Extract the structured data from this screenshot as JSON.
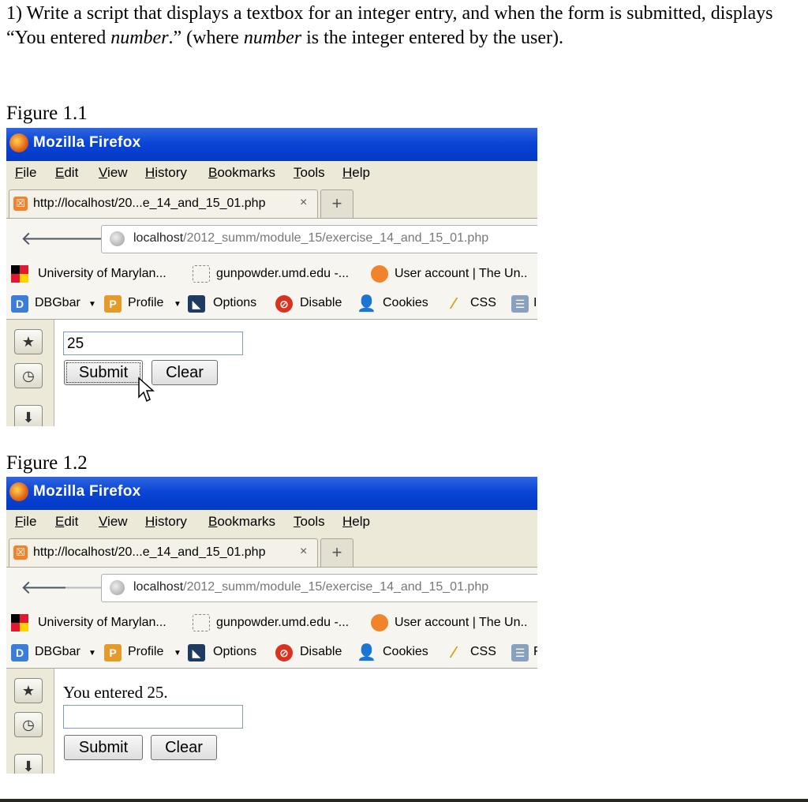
{
  "question": {
    "part1": "1) Write a script that displays a textbox for an integer entry, and when the form is submitted, displays “You entered ",
    "em1": "number",
    "part2": ".” (where ",
    "em2": "number",
    "part3": " is the integer entered by the user)."
  },
  "figures": [
    {
      "label": "Figure 1.1",
      "window_title": "Mozilla Firefox",
      "menu": [
        "File",
        "Edit",
        "View",
        "History",
        "Bookmarks",
        "Tools",
        "Help"
      ],
      "tab_title": "http://localhost/20...e_14_and_15_01.php",
      "tab_close": "×",
      "new_tab": "+",
      "url_host": "localhost",
      "url_path": "/2012_summ/module_15/exercise_14_and_15_01.php",
      "bookmarks": [
        "University of Marylan...",
        "gunpowder.umd.edu -...",
        "User account | The Un.."
      ],
      "toolbar": [
        "DBGbar",
        "Profile",
        "Options",
        "Disable",
        "Cookies",
        "CSS",
        "I"
      ],
      "result_text": "",
      "input_value": "25",
      "submit_label": "Submit",
      "clear_label": "Clear"
    },
    {
      "label": "Figure 1.2",
      "window_title": "Mozilla Firefox",
      "menu": [
        "File",
        "Edit",
        "View",
        "History",
        "Bookmarks",
        "Tools",
        "Help"
      ],
      "tab_title": "http://localhost/20...e_14_and_15_01.php",
      "tab_close": "×",
      "new_tab": "+",
      "url_host": "localhost",
      "url_path": "/2012_summ/module_15/exercise_14_and_15_01.php",
      "bookmarks": [
        "University of Marylan...",
        "gunpowder.umd.edu -...",
        "User account | The Un.."
      ],
      "toolbar": [
        "DBGbar",
        "Profile",
        "Options",
        "Disable",
        "Cookies",
        "CSS",
        "F"
      ],
      "result_text": "You entered 25.",
      "input_value": "",
      "submit_label": "Submit",
      "clear_label": "Clear"
    }
  ],
  "colors": {
    "titlebar": "#0a45d6",
    "chrome": "#ece9d8",
    "accent_orange": "#f1832b"
  }
}
